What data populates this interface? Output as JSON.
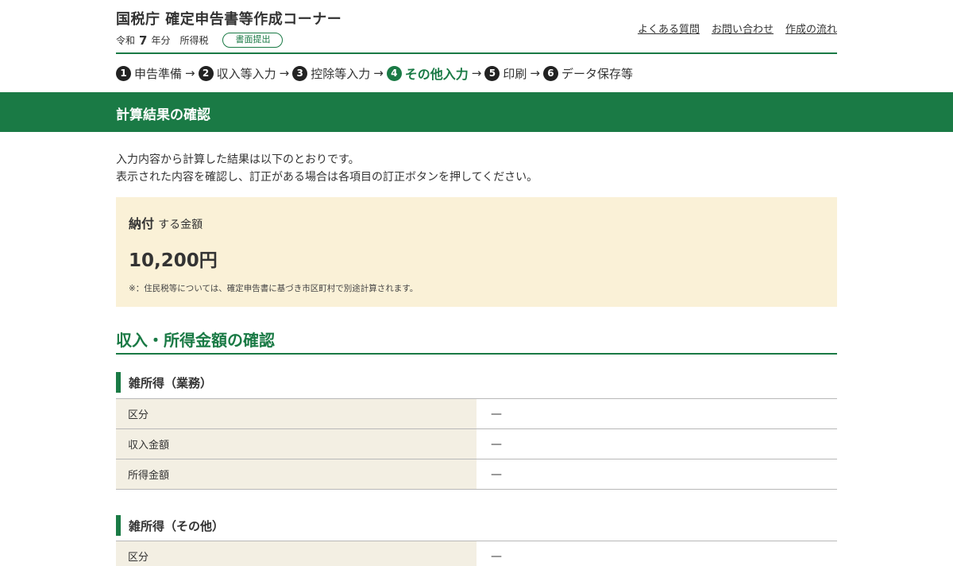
{
  "header": {
    "site_title": "国税庁 確定申告書等作成コーナー",
    "era": "令和",
    "year": "7",
    "year_unit": "年分",
    "tax_type": "所得税",
    "submission_badge": "書面提出",
    "links": [
      "よくある質問",
      "お問い合わせ",
      "作成の流れ"
    ]
  },
  "steps": [
    {
      "num": "1",
      "label": "申告準備"
    },
    {
      "num": "2",
      "label": "収入等入力"
    },
    {
      "num": "3",
      "label": "控除等入力"
    },
    {
      "num": "4",
      "label": "その他入力"
    },
    {
      "num": "5",
      "label": "印刷"
    },
    {
      "num": "6",
      "label": "データ保存等"
    }
  ],
  "current_step": 4,
  "arrow_symbol": "→",
  "banner": {
    "title": "計算結果の確認"
  },
  "intro": {
    "line1": "入力内容から計算した結果は以下のとおりです。",
    "line2": "表示された内容を確認し、訂正がある場合は各項目の訂正ボタンを押してください。"
  },
  "payment": {
    "label_strong": "納付",
    "label_rest": "する金額",
    "amount": "10,200円",
    "note": "※：住民税等については、確定申告書に基づき市区町村で別途計算されます。"
  },
  "section": {
    "title": "収入・所得金額の確認"
  },
  "subsections": [
    {
      "title": "雑所得（業務）",
      "rows": [
        {
          "label": "区分",
          "value": "—"
        },
        {
          "label": "収入金額",
          "value": "—"
        },
        {
          "label": "所得金額",
          "value": "—"
        }
      ]
    },
    {
      "title": "雑所得（その他）",
      "rows": [
        {
          "label": "区分",
          "value": "—"
        }
      ]
    }
  ],
  "colors": {
    "brand_green": "#1a7a45",
    "notice_bg": "#faf1d7",
    "table_label_bg": "#f3efe3"
  }
}
